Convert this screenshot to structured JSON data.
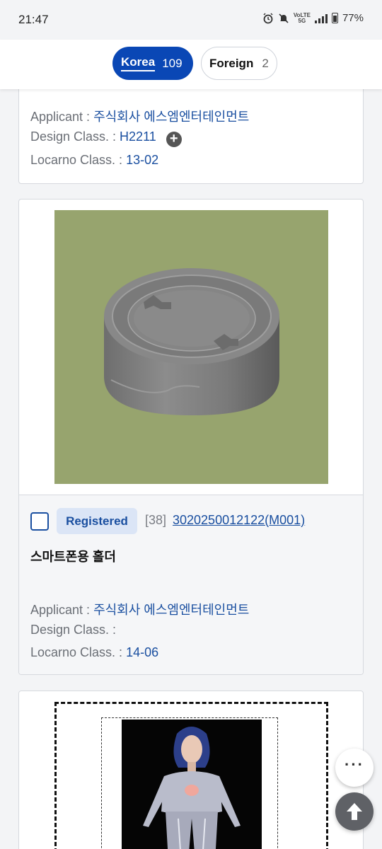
{
  "status_bar": {
    "time": "21:47",
    "network_volte": "VoLTE",
    "network_5g": "5G",
    "battery": "77%",
    "icons": [
      "alarm-icon",
      "mute-icon",
      "signal-icon",
      "battery-icon"
    ]
  },
  "tabs": [
    {
      "label": "Korea",
      "count": "109",
      "active": true
    },
    {
      "label": "Foreign",
      "count": "2",
      "active": false
    }
  ],
  "labels": {
    "applicant": "Applicant : ",
    "design_class": "Design Class. : ",
    "locarno_class": "Locarno Class. : "
  },
  "cards": [
    {
      "applicant": "주식회사 에스엠엔터테인먼트",
      "design_class": "H2211",
      "locarno_class": "13-02"
    },
    {
      "status": "Registered",
      "code": "[38]",
      "registration_no": "3020250012122(M001)",
      "title": "스마트폰용 홀더",
      "applicant": "주식회사 에스엠엔터테인먼트",
      "design_class": "",
      "locarno_class": "14-06",
      "image": "round-holder-render"
    },
    {
      "image": "character-figure-render"
    }
  ],
  "fab": {
    "more_label": "···",
    "top_icon": "arrow-up-icon"
  },
  "colors": {
    "accent": "#0a47b5",
    "link": "#1a4fa0",
    "image_bg": "#97a46e",
    "badge_bg": "#dbe5f6"
  }
}
